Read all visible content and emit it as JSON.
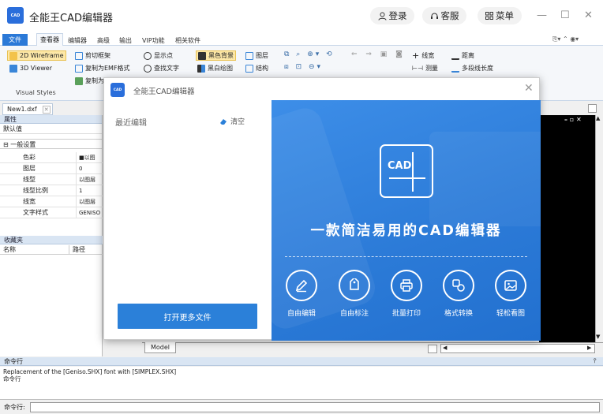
{
  "app": {
    "logo_text": "CAD",
    "title": "全能王CAD编辑器"
  },
  "titlebar": {
    "login_label": "登录",
    "service_label": "客服",
    "menu_label": "菜单"
  },
  "menubar": {
    "items": [
      "文件",
      "查看器",
      "编辑器",
      "高级",
      "输出",
      "VIP功能",
      "相关软件"
    ]
  },
  "ribbon": {
    "styles": [
      "2D Wireframe",
      "3D Viewer"
    ],
    "styles_group_label": "Visual Styles",
    "clip": [
      "剪切框架",
      "复制为EMF格式",
      "复制为"
    ],
    "display": [
      "显示点",
      "查找文字"
    ],
    "background": [
      "黑色背景",
      "黑白绘图"
    ],
    "layers": [
      "图层",
      "结构"
    ],
    "measure": [
      "线宽",
      "测量"
    ],
    "distance": [
      "距离",
      "多段线长度"
    ]
  },
  "document_tab": "New1.dxf",
  "properties": {
    "header": "属性",
    "default_label": "默认值",
    "group_label": "一般设置",
    "rows": [
      {
        "key": "色彩",
        "value": "■以图"
      },
      {
        "key": "图层",
        "value": "0"
      },
      {
        "key": "线型",
        "value": "以图层"
      },
      {
        "key": "线型比例",
        "value": "1"
      },
      {
        "key": "线宽",
        "value": "以图层"
      },
      {
        "key": "文字样式",
        "value": "GENISO"
      }
    ]
  },
  "favorites": {
    "header": "收藏夹",
    "col_name": "名称",
    "col_path": "路径"
  },
  "bottom": {
    "model_tab": "Model"
  },
  "command": {
    "header": "命令行",
    "log_line1": "Replacement of the [Geniso.SHX] font with [SIMPLEX.SHX]",
    "log_line2": "命令行",
    "prompt_label": "命令行:"
  },
  "dialog": {
    "title": "全能王CAD编辑器",
    "recent_label": "最近编辑",
    "clear_label": "清空",
    "open_more_label": "打开更多文件",
    "promo_logo_text": "CAD",
    "promo_slogan": "一款简洁易用的CAD编辑器",
    "features": [
      {
        "label": "自由编辑",
        "icon": "pencil-icon"
      },
      {
        "label": "自由标注",
        "icon": "tag-icon"
      },
      {
        "label": "批量打印",
        "icon": "printer-icon"
      },
      {
        "label": "格式转换",
        "icon": "convert-icon"
      },
      {
        "label": "轻松看图",
        "icon": "image-view-icon"
      }
    ]
  },
  "colors": {
    "accent": "#2b7ad7",
    "file_menu": "#2b79d7",
    "panel_header": "#d9e5f3"
  }
}
